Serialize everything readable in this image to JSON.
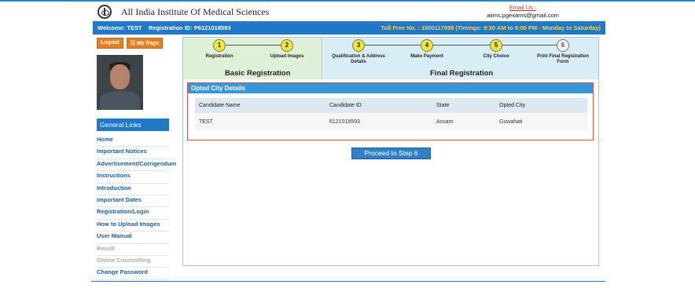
{
  "header": {
    "institute_name": "All India Institute Of Medical Sciences",
    "email_label": "Email Us :",
    "email_value": "aiims.pgexams@gmail.com"
  },
  "welcome_bar": {
    "welcome_text": "Welcome: TEST    Registration ID: P6121018593",
    "tollfree_text": "Toll Free No. : 1800117898 (Timings: 9:30 AM to 6:00 PM - Monday to Saturday)"
  },
  "sidebar": {
    "logout_label": "Logout",
    "mypage_label": "☷ My Page",
    "general_links_title": "General Links",
    "items": [
      {
        "label": "Home"
      },
      {
        "label": "Important Notices"
      },
      {
        "label": "Advertisement/Corrigendum"
      },
      {
        "label": "Instructions"
      },
      {
        "label": "Introduction"
      },
      {
        "label": "Important Dates"
      },
      {
        "label": "Registration/Login"
      },
      {
        "label": "How to Upload Images"
      },
      {
        "label": "User Manual"
      },
      {
        "label": "Result"
      },
      {
        "label": "Online Counselling"
      },
      {
        "label": "Change Password"
      }
    ]
  },
  "steps": {
    "basic_title": "Basic Registration",
    "final_title": "Final Registration",
    "items": [
      {
        "num": "1",
        "label": "Registration",
        "state": "done"
      },
      {
        "num": "2",
        "label": "Upload Images",
        "state": "done"
      },
      {
        "num": "3",
        "label": "Qualification & Address Details",
        "state": "done"
      },
      {
        "num": "4",
        "label": "Make Payment",
        "state": "done"
      },
      {
        "num": "5",
        "label": "City Choice",
        "state": "done"
      },
      {
        "num": "6",
        "label": "Print Final Registration Form",
        "state": "pending"
      }
    ]
  },
  "opted_city": {
    "title": "Opted City Details",
    "columns": [
      "Candidate Name",
      "Candidate ID",
      "State",
      "Opted City"
    ],
    "row": [
      "TEST",
      "6121018593",
      "Assam",
      "Guwahati"
    ]
  },
  "proceed_label": "Proceed to Step 6",
  "colors": {
    "accent_blue": "#1f78c8",
    "step_active": "#f3e82d",
    "button_orange": "#e67e22",
    "basic_bg": "#dff0d8",
    "final_bg": "#d9edf7"
  }
}
